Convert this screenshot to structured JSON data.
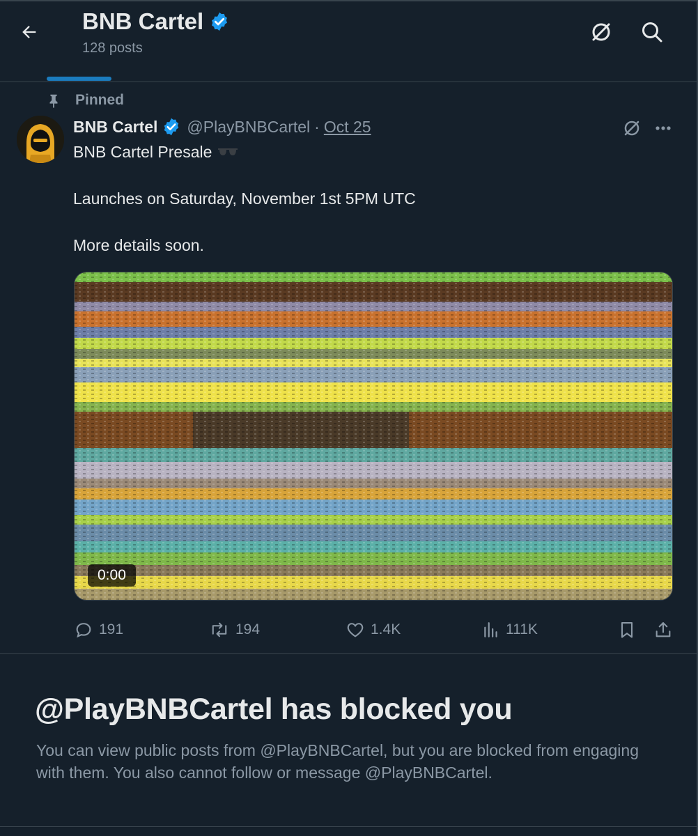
{
  "header": {
    "title": "BNB Cartel",
    "posts_count": "128 posts",
    "back_icon": "arrow-left-icon",
    "grok_icon": "grok-icon",
    "search_icon": "search-icon"
  },
  "post": {
    "pinned_label": "Pinned",
    "author_name": "BNB Cartel",
    "handle": "@PlayBNBCartel",
    "separator": "·",
    "date": "Oct 25",
    "lines": [
      "BNB Cartel Presale",
      "Launches on Saturday, November 1st 5PM UTC",
      "More details soon."
    ],
    "video_time": "0:00",
    "stats": {
      "replies": "191",
      "reposts": "194",
      "likes": "1.4K",
      "views": "111K"
    }
  },
  "blocked": {
    "title": "@PlayBNBCartel has blocked you",
    "description": "You can view public posts from @PlayBNBCartel, but you are blocked from engaging with them. You also cannot follow or message @PlayBNBCartel."
  },
  "colors": {
    "background": "#15202b",
    "accent": "#1d9bf0",
    "text_primary": "#e7e9ea",
    "text_secondary": "#8b98a5",
    "border": "#38444d"
  }
}
